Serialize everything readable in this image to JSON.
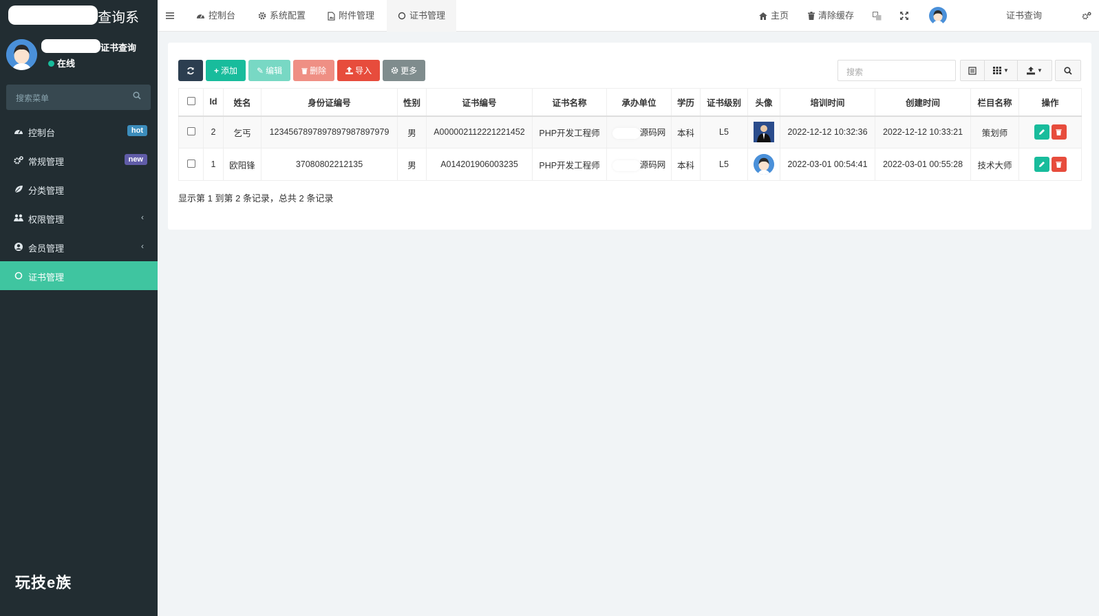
{
  "sidebar": {
    "logo_suffix": "查询系",
    "user": {
      "name_suffix": "证书查询",
      "status": "在线"
    },
    "search_placeholder": "搜索菜单",
    "menu": [
      {
        "label": "控制台",
        "icon": "dashboard-icon",
        "badge": "hot",
        "badge_color": "#3c8dbc"
      },
      {
        "label": "常规管理",
        "icon": "cogs-icon",
        "badge": "new",
        "badge_color": "#605ca8"
      },
      {
        "label": "分类管理",
        "icon": "leaf-icon"
      },
      {
        "label": "权限管理",
        "icon": "group-icon",
        "arrow": "‹"
      },
      {
        "label": "会员管理",
        "icon": "user-circle-icon",
        "arrow": "‹"
      },
      {
        "label": "证书管理",
        "icon": "circle-icon",
        "active": true
      }
    ],
    "footer_brand": "玩技e族"
  },
  "topbar": {
    "tabs": [
      {
        "label": "控制台",
        "icon": "dashboard-icon"
      },
      {
        "label": "系统配置",
        "icon": "gear-icon"
      },
      {
        "label": "附件管理",
        "icon": "file-image-icon"
      },
      {
        "label": "证书管理",
        "icon": "circle-icon",
        "active": true
      }
    ],
    "home": "主页",
    "clear_cache": "清除缓存",
    "right_user": "证书查询"
  },
  "toolbar": {
    "add": "添加",
    "edit": "编辑",
    "delete": "删除",
    "import": "导入",
    "more": "更多",
    "search_placeholder": "搜索"
  },
  "table": {
    "columns": [
      "Id",
      "姓名",
      "身份证编号",
      "性别",
      "证书编号",
      "证书名称",
      "承办单位",
      "学历",
      "证书级别",
      "头像",
      "培训时间",
      "创建时间",
      "栏目名称",
      "操作"
    ],
    "rows": [
      {
        "id": "2",
        "name": "乞丐",
        "id_card": "1234567897897897987897979",
        "gender": "男",
        "cert_no": "A000002112221221452",
        "cert_name": "PHP开发工程师",
        "unit": "源码网",
        "edu": "本科",
        "level": "L5",
        "avatar": "photo",
        "train_time": "2022-12-12 10:32:36",
        "create_time": "2022-12-12 10:33:21",
        "category": "策划师"
      },
      {
        "id": "1",
        "name": "欧阳锋",
        "id_card": "37080802212135",
        "gender": "男",
        "cert_no": "A014201906003235",
        "cert_name": "PHP开发工程师",
        "unit": "源码网",
        "edu": "本科",
        "level": "L5",
        "avatar": "cartoon",
        "train_time": "2022-03-01 00:54:41",
        "create_time": "2022-03-01 00:55:28",
        "category": "技术大师"
      }
    ]
  },
  "pager": {
    "summary": "显示第 1 到第 2 条记录，总共 2 条记录"
  }
}
